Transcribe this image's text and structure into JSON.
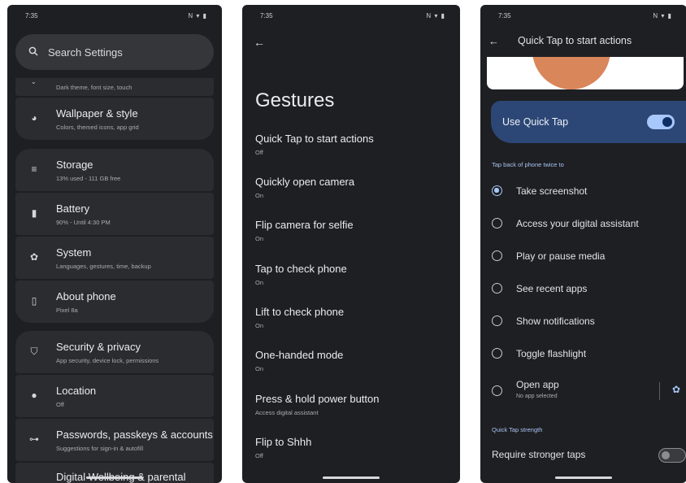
{
  "phone1": {
    "status": {
      "time": "7:35",
      "icons": "N ▾ ▮"
    },
    "search": {
      "icon": "search-icon",
      "placeholder": "Search Settings"
    },
    "top_partial_subtitle": "Dark theme, font size, touch",
    "items": [
      {
        "icon": "palette-icon",
        "title": "Wallpaper & style",
        "subtitle": "Colors, themed icons, app grid"
      },
      {
        "icon": "storage-icon",
        "title": "Storage",
        "subtitle": "13% used - 111 GB free"
      },
      {
        "icon": "battery-icon",
        "title": "Battery",
        "subtitle": "90% - Until 4:30 PM"
      },
      {
        "icon": "gear-icon",
        "title": "System",
        "subtitle": "Languages, gestures, time, backup"
      },
      {
        "icon": "phone-icon",
        "title": "About phone",
        "subtitle": "Pixel 8a"
      },
      {
        "icon": "shield-icon",
        "title": "Security & privacy",
        "subtitle": "App security, device lock, permissions"
      },
      {
        "icon": "location-icon",
        "title": "Location",
        "subtitle": "Off"
      },
      {
        "icon": "key-icon",
        "title": "Passwords, passkeys & accounts",
        "subtitle": "Suggestions for sign-in & autofill"
      },
      {
        "icon": "wellbeing-icon",
        "title": "Digital Wellbeing & parental",
        "subtitle": ""
      }
    ]
  },
  "phone2": {
    "status": {
      "time": "7:35",
      "icons": "N ▾ ▮"
    },
    "back": "←",
    "title": "Gestures",
    "items": [
      {
        "title": "Quick Tap to start actions",
        "subtitle": "Off"
      },
      {
        "title": "Quickly open camera",
        "subtitle": "On"
      },
      {
        "title": "Flip camera for selfie",
        "subtitle": "On"
      },
      {
        "title": "Tap to check phone",
        "subtitle": "On"
      },
      {
        "title": "Lift to check phone",
        "subtitle": "On"
      },
      {
        "title": "One-handed mode",
        "subtitle": "On"
      },
      {
        "title": "Press & hold power button",
        "subtitle": "Access digital assistant"
      },
      {
        "title": "Flip to Shhh",
        "subtitle": "Off"
      }
    ]
  },
  "phone3": {
    "status": {
      "time": "7:35",
      "icons": "N ▾ ▮"
    },
    "back": "←",
    "title": "Quick Tap to start actions",
    "toggle": {
      "label": "Use Quick Tap",
      "on": true
    },
    "section1": "Tap back of phone twice to",
    "options": [
      {
        "label": "Take screenshot",
        "selected": true
      },
      {
        "label": "Access your digital assistant",
        "selected": false
      },
      {
        "label": "Play or pause media",
        "selected": false
      },
      {
        "label": "See recent apps",
        "selected": false
      },
      {
        "label": "Show notifications",
        "selected": false
      },
      {
        "label": "Toggle flashlight",
        "selected": false
      },
      {
        "label": "Open app",
        "subtitle": "No app selected",
        "selected": false
      }
    ],
    "section2": "Quick Tap strength",
    "stronger": {
      "label": "Require stronger taps",
      "on": false
    }
  }
}
